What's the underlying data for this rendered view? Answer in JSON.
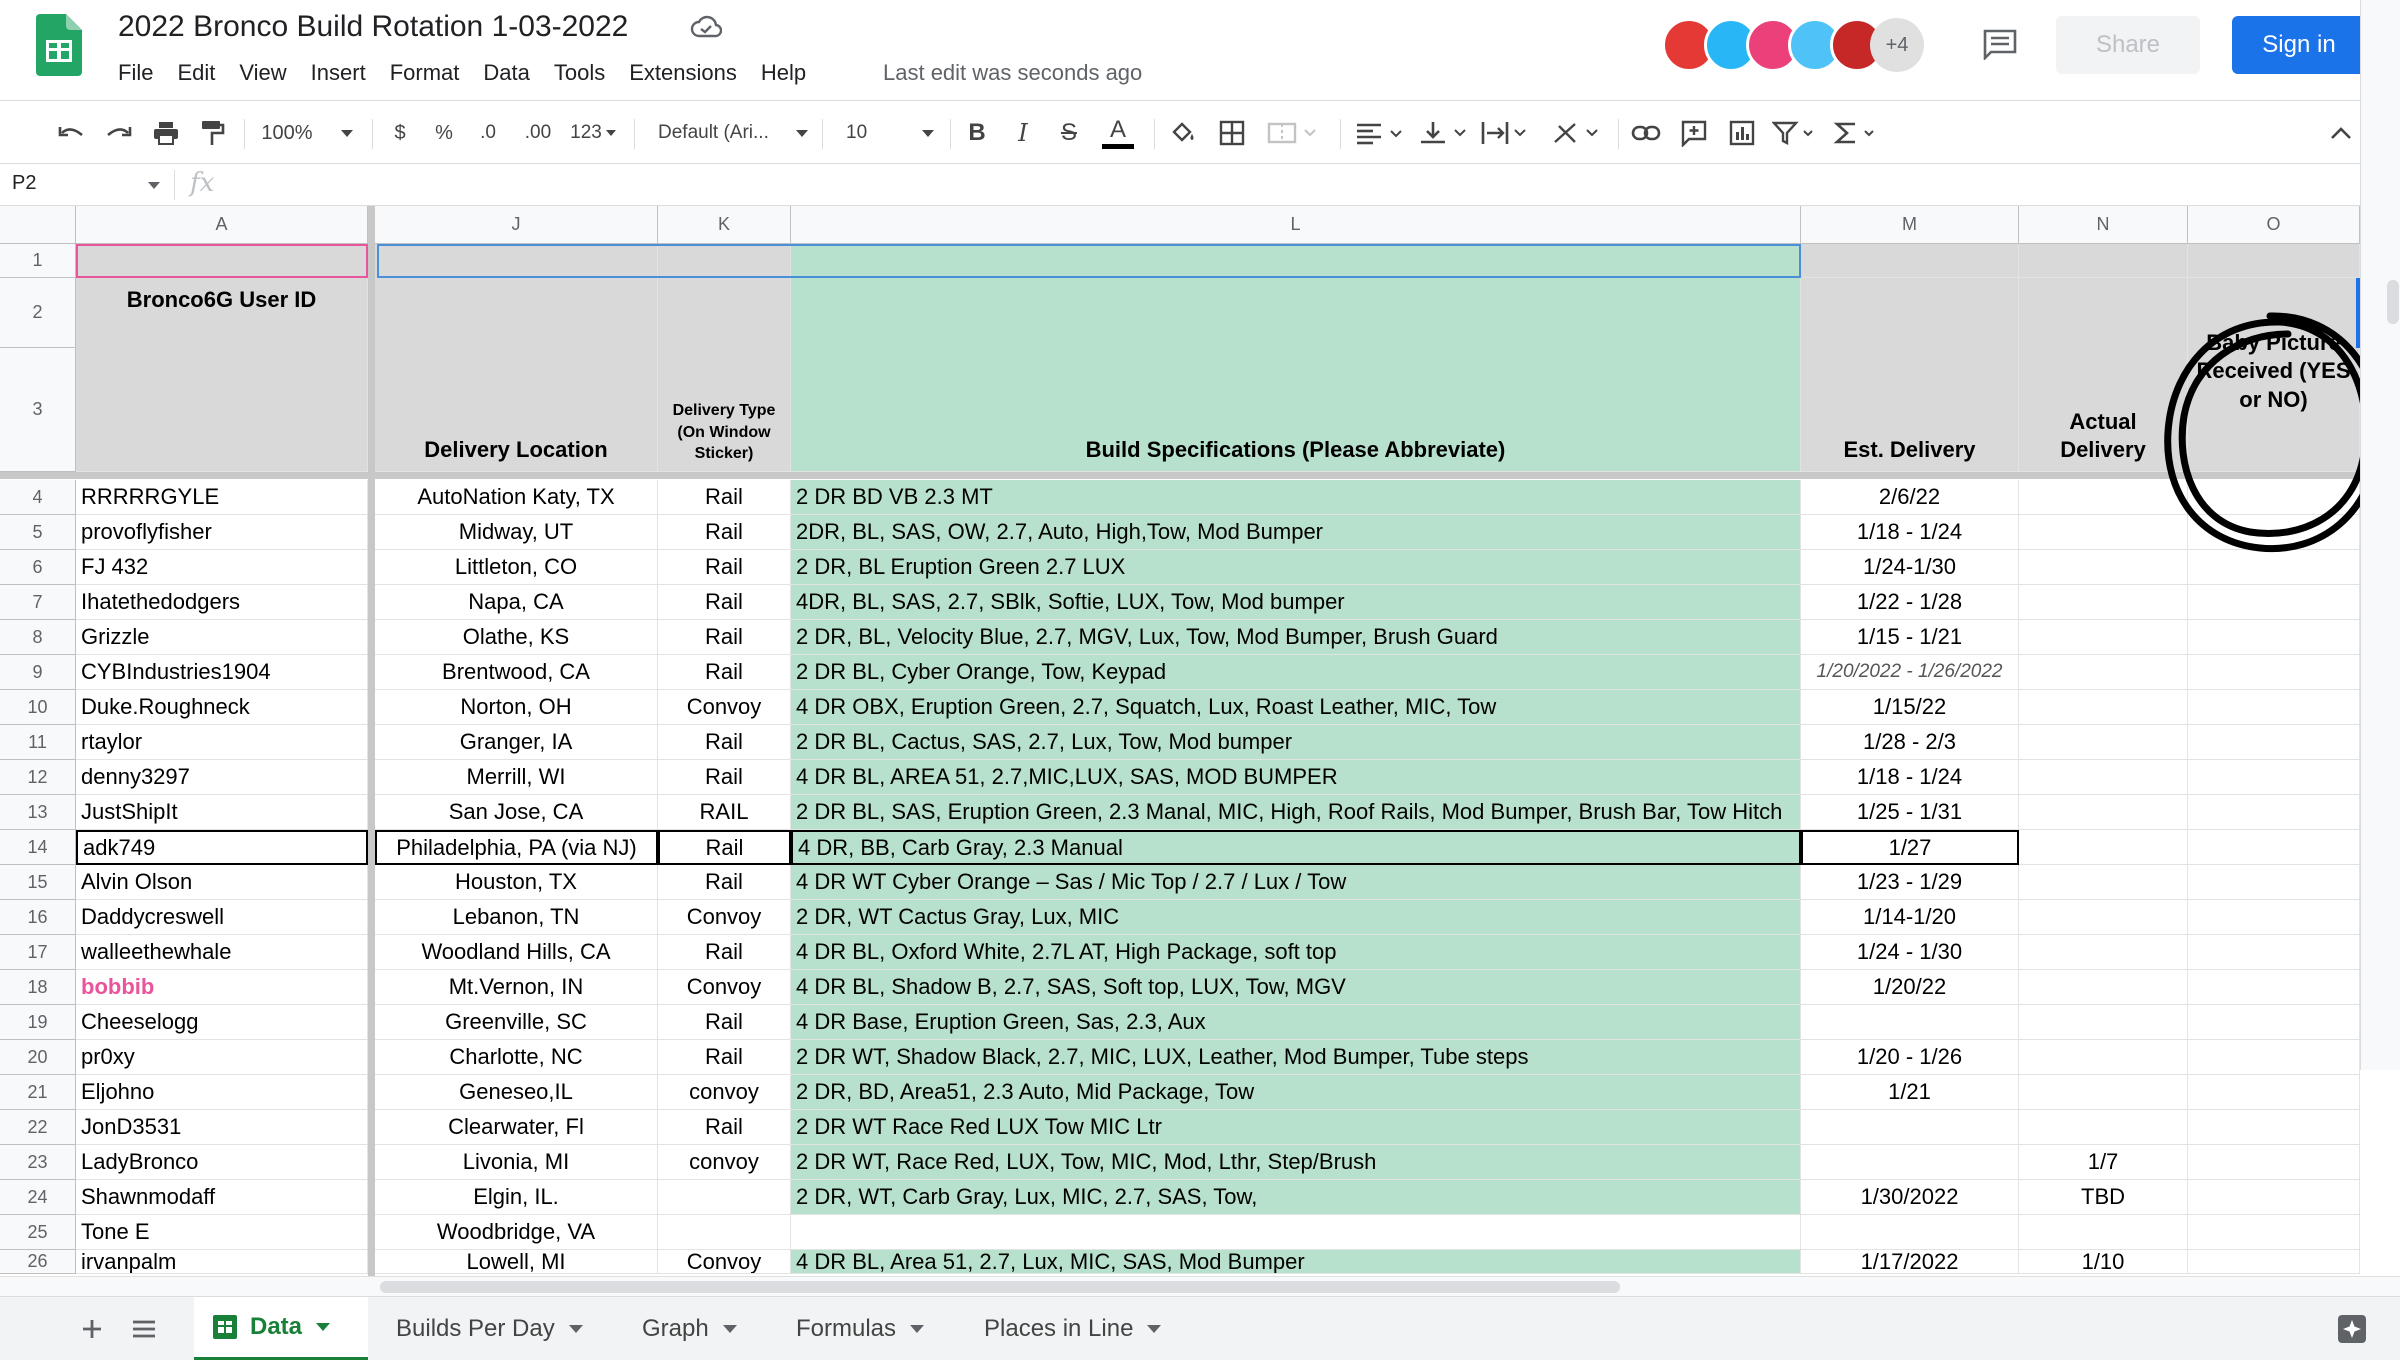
{
  "header": {
    "title": "2022 Bronco Build Rotation 1-03-2022",
    "menu": [
      "File",
      "Edit",
      "View",
      "Insert",
      "Format",
      "Data",
      "Tools",
      "Extensions",
      "Help"
    ],
    "last_edit": "Last edit was seconds ago",
    "avatar_more": "+4",
    "share_label": "Share",
    "signin_label": "Sign in",
    "avatar_colors": [
      "#e53935",
      "#29b6f6",
      "#ec407a",
      "#4fc3f7",
      "#c62828"
    ]
  },
  "toolbar": {
    "zoom": "100%",
    "currency": "$",
    "percent": "%",
    "dec_decrease": ".0",
    "dec_increase": ".00",
    "more_formats": "123",
    "font": "Default (Ari...",
    "font_size": "10",
    "bold": "B",
    "italic": "I",
    "strike": "S",
    "text_color": "A"
  },
  "formula_bar": {
    "name_box": "P2",
    "fx": "fx"
  },
  "columns": [
    "A",
    "J",
    "K",
    "L",
    "M",
    "N",
    "O"
  ],
  "header_rows": {
    "A": "Bronco6G User ID",
    "J": "Delivery Location",
    "K": "Delivery Type (On Window Sticker)",
    "L": "Build Specifications (Please Abbreviate)",
    "M": "Est. Delivery",
    "N": "Actual Delivery",
    "O": "Baby Picture Received (YES or NO)"
  },
  "rows": [
    {
      "n": "4",
      "a": "RRRRRGYLE",
      "j": "AutoNation Katy, TX",
      "k": "Rail",
      "l": "2 DR BD VB 2.3 MT",
      "m": "2/6/22",
      "nn": ""
    },
    {
      "n": "5",
      "a": "provoflyfisher",
      "j": "Midway, UT",
      "k": "Rail",
      "l": "2DR, BL, SAS, OW, 2.7, Auto, High,Tow, Mod Bumper",
      "m": "1/18 - 1/24",
      "nn": ""
    },
    {
      "n": "6",
      "a": "FJ 432",
      "j": "Littleton, CO",
      "k": "Rail",
      "l": "2 DR, BL Eruption Green 2.7 LUX",
      "m": "1/24-1/30",
      "nn": ""
    },
    {
      "n": "7",
      "a": "Ihatethedodgers",
      "j": "Napa, CA",
      "k": "Rail",
      "l": "4DR, BL, SAS, 2.7, SBlk, Softie, LUX, Tow, Mod bumper",
      "m": "1/22 - 1/28",
      "nn": ""
    },
    {
      "n": "8",
      "a": "Grizzle",
      "j": "Olathe, KS",
      "k": "Rail",
      "l": "2 DR, BL, Velocity Blue, 2.7, MGV, Lux, Tow, Mod Bumper, Brush Guard",
      "m": "1/15 - 1/21",
      "nn": ""
    },
    {
      "n": "9",
      "a": "CYBIndustries1904",
      "j": "Brentwood, CA",
      "k": "Rail",
      "l": "2 DR BL, Cyber Orange, Tow, Keypad",
      "m": "1/20/2022 - 1/26/2022",
      "nn": ""
    },
    {
      "n": "10",
      "a": "Duke.Roughneck",
      "j": "Norton, OH",
      "k": "Convoy",
      "l": "4 DR OBX, Eruption Green, 2.7, Squatch, Lux, Roast Leather, MIC, Tow",
      "m": "1/15/22",
      "nn": ""
    },
    {
      "n": "11",
      "a": "rtaylor",
      "j": "Granger, IA",
      "k": "Rail",
      "l": "2 DR BL, Cactus, SAS, 2.7, Lux, Tow, Mod bumper",
      "m": "1/28 - 2/3",
      "nn": ""
    },
    {
      "n": "12",
      "a": "denny3297",
      "j": "Merrill, WI",
      "k": "Rail",
      "l": "4 DR BL, AREA 51, 2.7,MIC,LUX, SAS, MOD BUMPER",
      "m": "1/18 - 1/24",
      "nn": ""
    },
    {
      "n": "13",
      "a": "JustShipIt",
      "j": "San Jose, CA",
      "k": "RAIL",
      "l": "2 DR BL, SAS, Eruption Green, 2.3 Manal, MIC, High, Roof Rails, Mod Bumper, Brush Bar, Tow Hitch",
      "m": "1/25 - 1/31",
      "nn": ""
    },
    {
      "n": "14",
      "a": "adk749",
      "j": "Philadelphia, PA (via NJ)",
      "k": "Rail",
      "l": "4 DR, BB, Carb Gray, 2.3 Manual",
      "m": "1/27",
      "nn": ""
    },
    {
      "n": "15",
      "a": "Alvin Olson",
      "j": "Houston, TX",
      "k": "Rail",
      "l": "4 DR WT Cyber Orange – Sas / Mic Top / 2.7 / Lux / Tow",
      "m": "1/23 - 1/29",
      "nn": ""
    },
    {
      "n": "16",
      "a": "Daddycreswell",
      "j": "Lebanon, TN",
      "k": "Convoy",
      "l": "2 DR, WT Cactus Gray, Lux, MIC",
      "m": "1/14-1/20",
      "nn": ""
    },
    {
      "n": "17",
      "a": "walleethewhale",
      "j": "Woodland Hills, CA",
      "k": "Rail",
      "l": "4 DR BL, Oxford White, 2.7L AT, High Package, soft top",
      "m": "1/24 - 1/30",
      "nn": ""
    },
    {
      "n": "18",
      "a": "bobbib",
      "j": "Mt.Vernon, IN",
      "k": "Convoy",
      "l": "4 DR BL, Shadow B, 2.7, SAS, Soft top, LUX, Tow, MGV",
      "m": "1/20/22",
      "nn": ""
    },
    {
      "n": "19",
      "a": "Cheeselogg",
      "j": "Greenville, SC",
      "k": "Rail",
      "l": "4 DR Base, Eruption Green, Sas, 2.3, Aux",
      "m": "",
      "nn": ""
    },
    {
      "n": "20",
      "a": "pr0xy",
      "j": "Charlotte, NC",
      "k": "Rail",
      "l": "2 DR WT, Shadow Black, 2.7, MIC, LUX, Leather, Mod Bumper, Tube steps",
      "m": "1/20 - 1/26",
      "nn": ""
    },
    {
      "n": "21",
      "a": "Eljohno",
      "j": "Geneseo,IL",
      "k": "convoy",
      "l": "2 DR, BD, Area51, 2.3 Auto, Mid Package, Tow",
      "m": "1/21",
      "nn": ""
    },
    {
      "n": "22",
      "a": "JonD3531",
      "j": "Clearwater, Fl",
      "k": "Rail",
      "l": "2 DR WT Race Red LUX Tow MIC Ltr",
      "m": "",
      "nn": ""
    },
    {
      "n": "23",
      "a": "LadyBronco",
      "j": "Livonia, MI",
      "k": "convoy",
      "l": "2 DR WT, Race Red, LUX, Tow, MIC, Mod, Lthr, Step/Brush",
      "m": "",
      "nn": "1/7"
    },
    {
      "n": "24",
      "a": "Shawnmodaff",
      "j": "Elgin, IL.",
      "k": "",
      "l": "2 DR, WT, Carb Gray, Lux, MIC, 2.7, SAS, Tow,",
      "m": "1/30/2022",
      "nn": "TBD"
    },
    {
      "n": "25",
      "a": "Tone E",
      "j": "Woodbridge,  VA",
      "k": "",
      "l": "",
      "m": "",
      "nn": ""
    },
    {
      "n": "26",
      "a": "irvanpalm",
      "j": "Lowell, MI",
      "k": "Convoy",
      "l": "4 DR BL, Area 51, 2.7, Lux, MIC, SAS, Mod Bumper",
      "m": "1/17/2022",
      "nn": "1/10"
    }
  ],
  "sheet_tabs": [
    "Data",
    "Builds Per Day",
    "Graph",
    "Formulas",
    "Places in Line"
  ],
  "colors": {
    "spec_fill": "#b7e1cd",
    "header_fill": "#d9d9d9",
    "accent": "#1a73e8",
    "sheets_green": "#188038"
  }
}
